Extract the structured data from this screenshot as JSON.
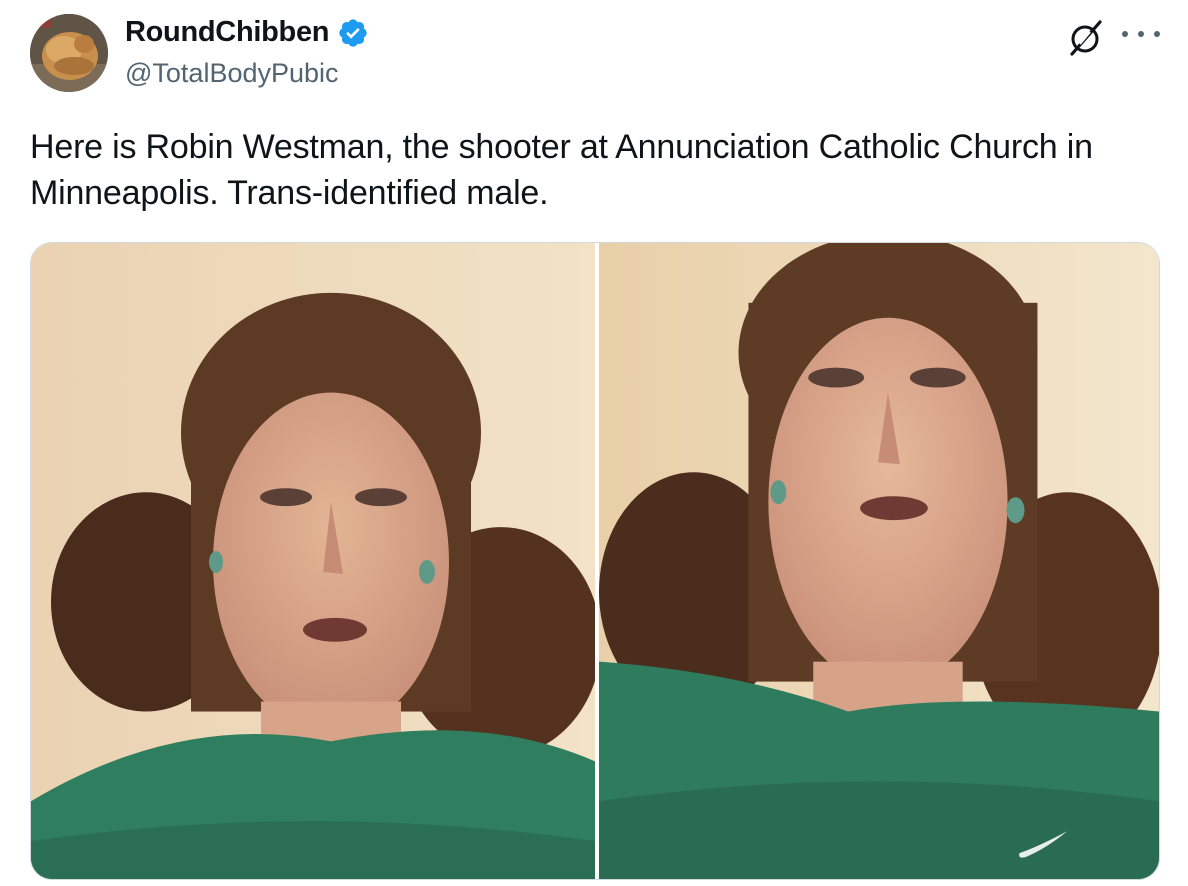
{
  "author": {
    "display_name": "RoundChibben",
    "handle": "@TotalBodyPubic",
    "verified": true,
    "avatar_icon": "chicken-avatar"
  },
  "actions": {
    "grok_icon": "grok-icon",
    "more_icon": "more-icon"
  },
  "tweet": {
    "text": "Here is Robin Westman, the shooter at Annunciation Catholic Church in\nMinneapolis. Trans-identified male."
  },
  "media": {
    "count": 2,
    "photos": [
      {
        "name": "photo-1"
      },
      {
        "name": "photo-2"
      }
    ]
  },
  "colors": {
    "verified_blue": "#1d9bf0",
    "secondary_text": "#536471",
    "border": "#cfd9de"
  }
}
